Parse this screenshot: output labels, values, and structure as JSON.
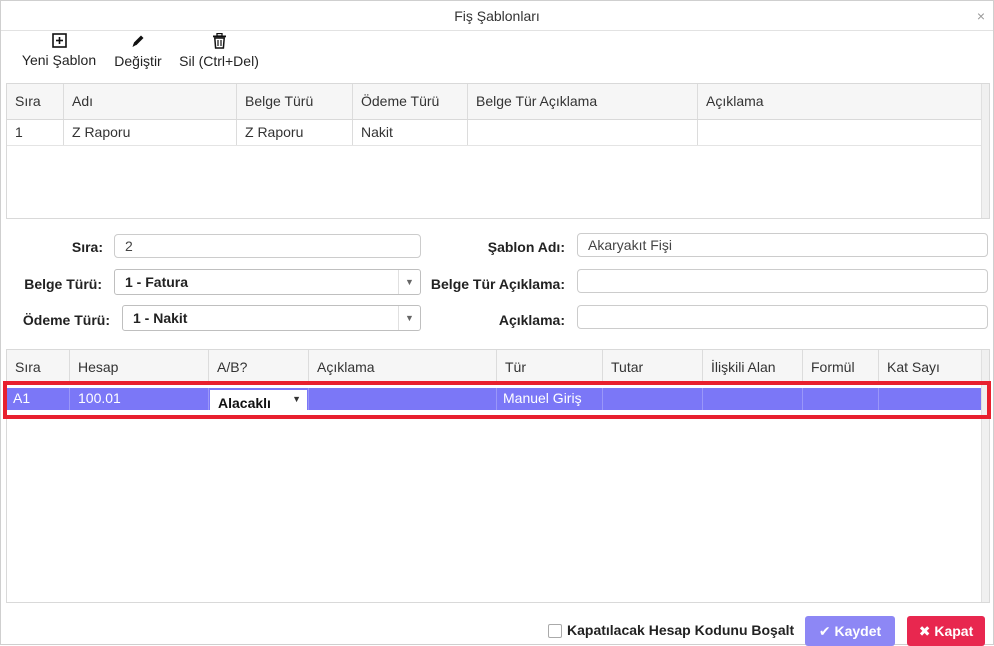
{
  "window": {
    "title": "Fiş Şablonları",
    "close_glyph": "×"
  },
  "toolbar": {
    "new_label": "Yeni Şablon",
    "new_icon": "plus-square-icon",
    "edit_label": "Değiştir",
    "edit_icon": "pencil-icon",
    "delete_label": "Sil (Ctrl+Del)",
    "delete_icon": "trash-icon"
  },
  "templates_grid": {
    "columns": [
      "Sıra",
      "Adı",
      "Belge Türü",
      "Ödeme Türü",
      "Belge Tür Açıklama",
      "Açıklama"
    ],
    "rows": [
      [
        "1",
        "Z Raporu",
        "Z Raporu",
        "Nakit",
        "",
        ""
      ]
    ]
  },
  "form": {
    "sira_label": "Sıra:",
    "sira_value": "2",
    "sablon_adi_label": "Şablon Adı:",
    "sablon_adi_value": "Akaryakıt Fişi",
    "belge_turu_label": "Belge Türü:",
    "belge_turu_value": "1 - Fatura",
    "belge_tur_aciklama_label": "Belge Tür Açıklama:",
    "belge_tur_aciklama_value": "",
    "odeme_turu_label": "Ödeme Türü:",
    "odeme_turu_value": "1 - Nakit",
    "aciklama_label": "Açıklama:",
    "aciklama_value": ""
  },
  "lines_grid": {
    "columns": [
      "Sıra",
      "Hesap",
      "A/B?",
      "Açıklama",
      "Tür",
      "Tutar",
      "İlişkili Alan",
      "Formül",
      "Kat Sayı"
    ],
    "rows": [
      {
        "sira": "A1",
        "hesap": "100.01",
        "ab": "Alacaklı",
        "aciklama": "",
        "tur": "Manuel Giriş",
        "tutar": "",
        "iliskili_alan": "",
        "formul": "",
        "kat_sayi": ""
      }
    ]
  },
  "footer": {
    "checkbox_label": "Kapatılacak Hesap Kodunu Boşalt",
    "save_label": "Kaydet",
    "close_label": "Kapat"
  },
  "colors": {
    "selected_row": "#7b77f7",
    "highlight_outline": "#e8202e",
    "save_button": "#8d87f5",
    "close_button": "#e8274f"
  }
}
